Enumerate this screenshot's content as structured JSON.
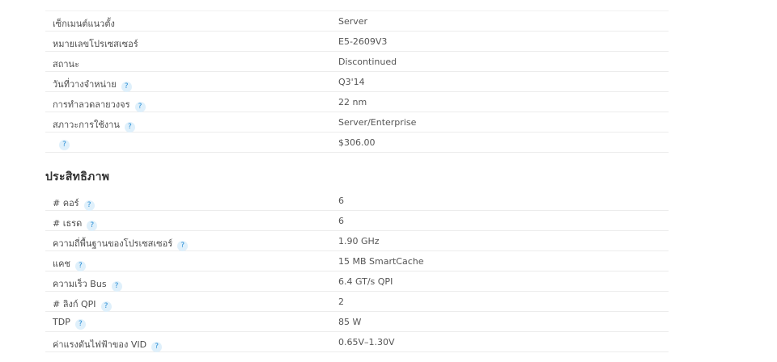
{
  "essentials": {
    "rows": [
      {
        "label": "เซ็กเมนต์แนวตั้ง",
        "value": "Server",
        "help": false
      },
      {
        "label": "หมายเลขโปรเซสเซอร์",
        "value": "E5-2609V3",
        "help": false
      },
      {
        "label": "สถานะ",
        "value": "Discontinued",
        "help": false
      },
      {
        "label": "วันที่วางจำหน่าย",
        "value": "Q3'14",
        "help": true
      },
      {
        "label": "การทำลวดลายวงจร",
        "value": "22 nm",
        "help": true
      },
      {
        "label": "สภาวะการใช้งาน",
        "value": "Server/Enterprise",
        "help": true
      },
      {
        "label": "",
        "value": "$306.00",
        "help": true
      }
    ]
  },
  "performance": {
    "heading": "ประสิทธิภาพ",
    "rows": [
      {
        "label": "# คอร์",
        "value": "6",
        "help": true
      },
      {
        "label": "# เธรด",
        "value": "6",
        "help": true
      },
      {
        "label": "ความถี่พื้นฐานของโปรเซสเซอร์",
        "value": "1.90 GHz",
        "help": true
      },
      {
        "label": "แคช",
        "value": "15 MB SmartCache",
        "help": true
      },
      {
        "label": "ความเร็ว Bus",
        "value": "6.4 GT/s QPI",
        "help": true
      },
      {
        "label": "# ลิงก์ QPI",
        "value": "2",
        "help": true
      },
      {
        "label": "TDP",
        "value": "85 W",
        "help": true
      },
      {
        "label": "ค่าแรงดันไฟฟ้าของ VID",
        "value": "0.65V–1.30V",
        "help": true
      }
    ]
  },
  "help_glyph": "?",
  "icons": {
    "help": "help-circle-icon"
  },
  "colors": {
    "help_bg": "#dff0fb",
    "help_fg": "#2c8fd6",
    "rule": "#ececec"
  }
}
